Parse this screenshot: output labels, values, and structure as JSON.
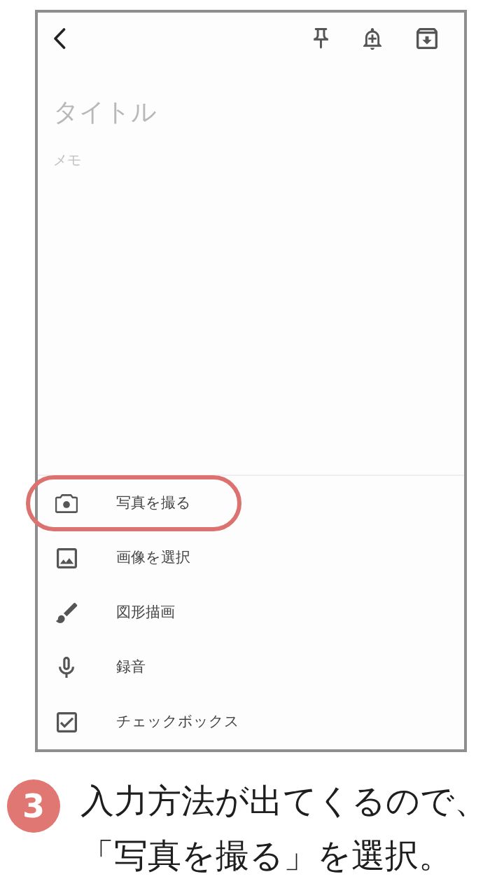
{
  "note": {
    "title": {
      "placeholder": "タイトル"
    },
    "body": {
      "placeholder": "メモ"
    }
  },
  "menu": [
    {
      "kind": "camera",
      "label": "写真を撮る",
      "highlighted": true
    },
    {
      "kind": "image",
      "label": "画像を選択",
      "highlighted": false
    },
    {
      "kind": "brush",
      "label": "図形描画",
      "highlighted": false
    },
    {
      "kind": "mic",
      "label": "録音",
      "highlighted": false
    },
    {
      "kind": "checkbox",
      "label": "チェックボックス",
      "highlighted": false
    }
  ],
  "caption": {
    "step": "3",
    "text": "入力方法が出てくるので、「写真を撮る」を選択。"
  }
}
